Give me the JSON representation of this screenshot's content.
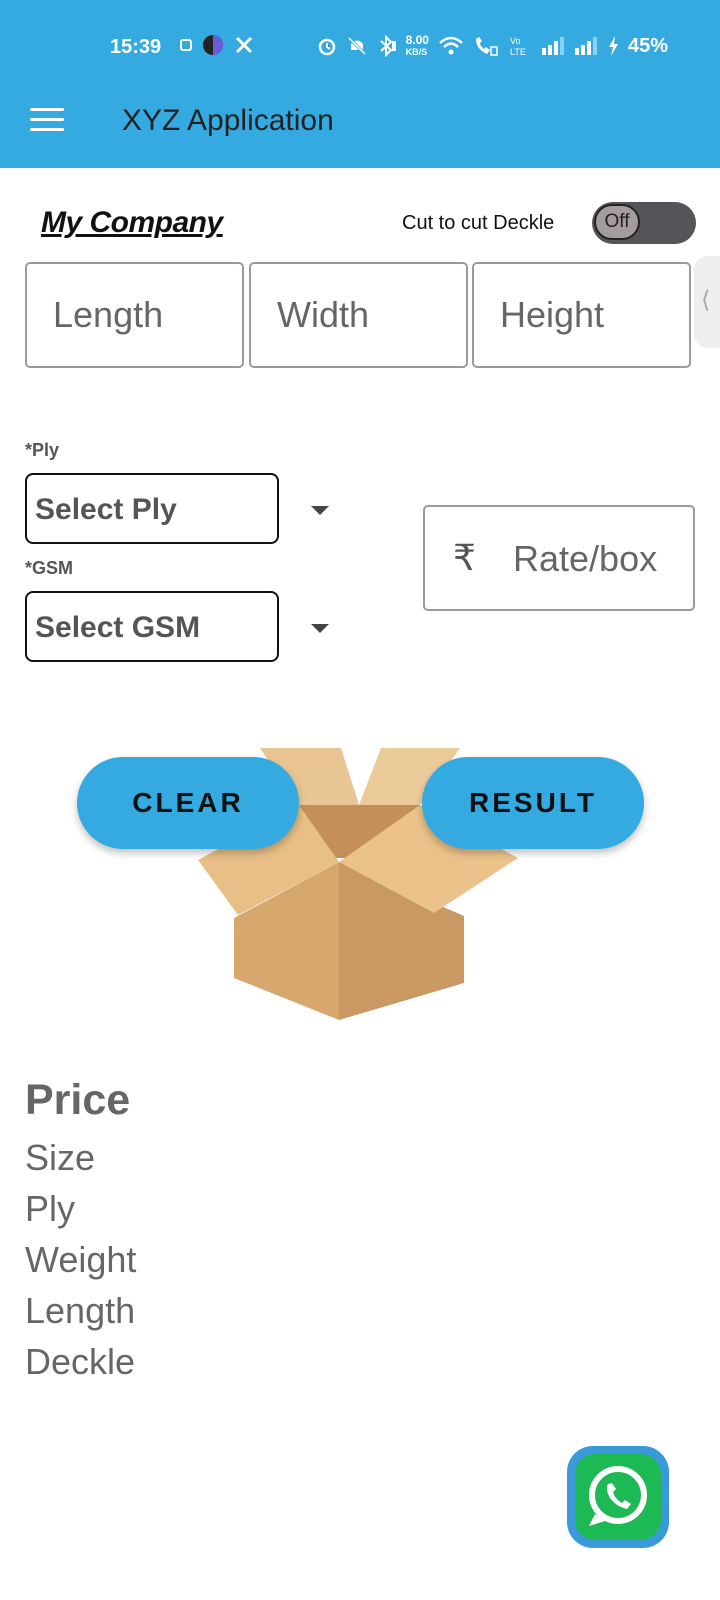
{
  "status_bar": {
    "time": "15:39",
    "network_speed": "8.00",
    "network_speed_unit": "KB/S",
    "battery": "45%",
    "icons": [
      "sim-icon",
      "moon-icon",
      "x-icon",
      "alarm-icon",
      "mute-icon",
      "bluetooth-icon",
      "wifi-icon",
      "wifi-call-icon",
      "volte-icon",
      "signal-icon",
      "signal-icon",
      "charging-icon"
    ]
  },
  "app_bar": {
    "title": "XYZ Application",
    "menu_icon": "hamburger-menu-icon",
    "color": "#34aae1"
  },
  "header": {
    "company": "My Company",
    "deckle_label": "Cut to cut Deckle",
    "toggle_state": "Off"
  },
  "dimensions": {
    "length_placeholder": "Length",
    "width_placeholder": "Width",
    "height_placeholder": "Height"
  },
  "ply": {
    "label": "*Ply",
    "selected": "Select Ply"
  },
  "gsm": {
    "label": "*GSM",
    "selected": "Select GSM"
  },
  "rate": {
    "currency_symbol": "₹",
    "placeholder": "Rate/box"
  },
  "actions": {
    "clear_label": "CLEAR",
    "result_label": "RESULT"
  },
  "results": {
    "title": "Price",
    "lines": [
      "Size",
      "Ply",
      "Weight",
      "Length",
      "Deckle"
    ]
  },
  "fab": {
    "icon": "whatsapp-icon",
    "color": "#1db954"
  }
}
